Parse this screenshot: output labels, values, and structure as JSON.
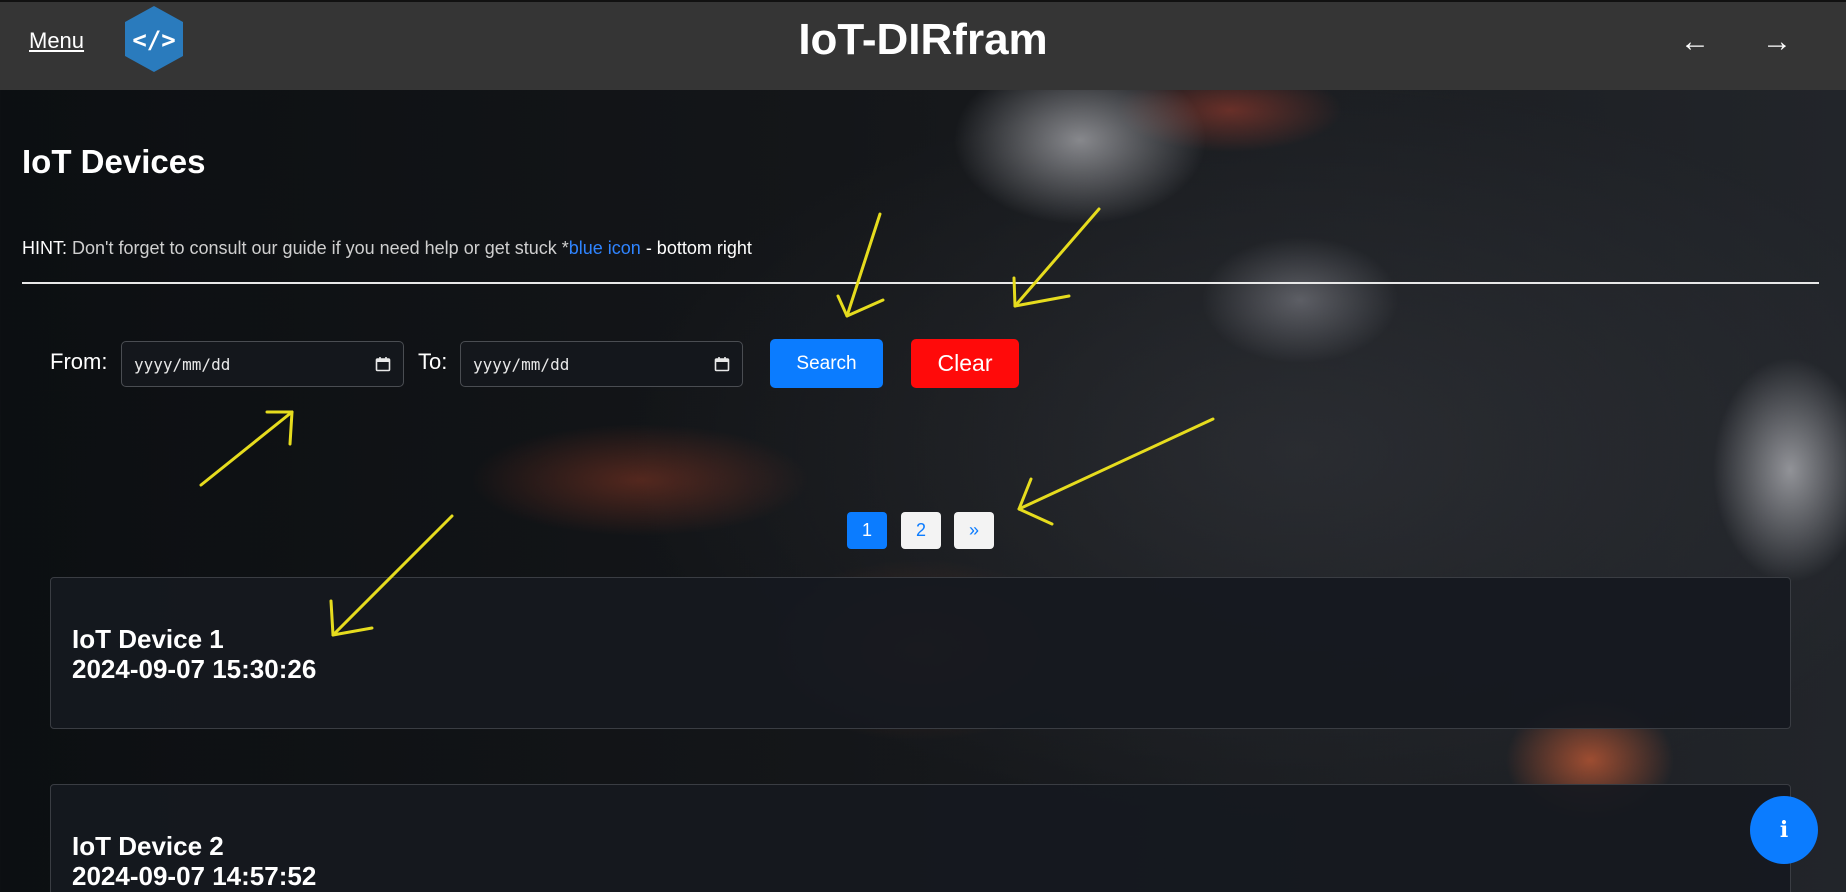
{
  "header": {
    "menu_label": "Menu",
    "logo_glyph": "</>",
    "title": "IoT-DIRfram",
    "back_arrow": "←",
    "forward_arrow": "→"
  },
  "main": {
    "heading": "IoT Devices",
    "hint": {
      "label": "HINT:",
      "text": " Don't forget to consult our guide if you need help or get stuck *",
      "link": "blue icon",
      "tail": " - bottom right"
    }
  },
  "filter": {
    "from_label": "From:",
    "to_label": "To:",
    "from_placeholder": "yyyy/mm/dd",
    "to_placeholder": "yyyy/mm/dd",
    "search_label": "Search",
    "clear_label": "Clear"
  },
  "pagination": {
    "pages": [
      "1",
      "2"
    ],
    "next": "»",
    "current": "1"
  },
  "devices": [
    {
      "name": "IoT Device 1",
      "timestamp": "2024-09-07 15:30:26"
    },
    {
      "name": "IoT Device 2",
      "timestamp": "2024-09-07 14:57:52"
    }
  ],
  "info_button": {
    "glyph": "i"
  },
  "colors": {
    "topbar": "#353535",
    "primary": "#0b7cff",
    "danger": "#ff0a0a",
    "annotation": "#e6dc1e"
  }
}
